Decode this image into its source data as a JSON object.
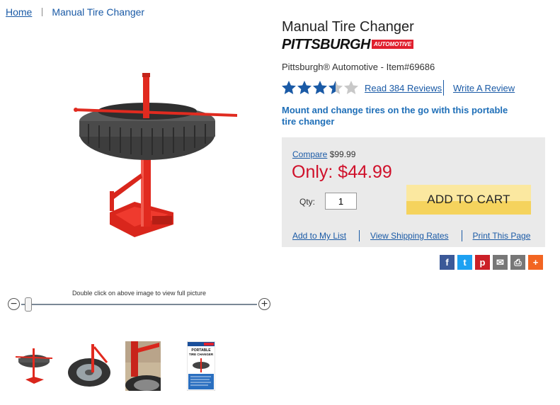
{
  "breadcrumb": {
    "home": "Home",
    "current": "Manual Tire Changer"
  },
  "product": {
    "title": "Manual Tire Changer",
    "brand_main": "PITTSBURGH",
    "brand_sub": "AUTOMOTIVE",
    "subtitle": "Pittsburgh® Automotive - Item#69686",
    "rating": 3.5,
    "rating_max": 5,
    "reviews_link": "Read 384 Reviews",
    "write_review": "Write A Review",
    "tagline": "Mount and change tires on the go with this portable tire changer"
  },
  "pricing": {
    "compare_label": "Compare",
    "compare_price": "$99.99",
    "only_label": "Only: $44.99",
    "qty_label": "Qty:",
    "qty_value": "1",
    "add_to_cart": "ADD TO CART",
    "links": [
      "Add to My List",
      "View Shipping Rates",
      "Print This Page"
    ]
  },
  "image_viewer": {
    "caption": "Double click on above image to view full picture",
    "zoom_level": 0
  },
  "thumb_text": {
    "title_line1": "PORTABLE",
    "title_line2": "TIRE CHANGER"
  },
  "share": [
    {
      "icon": "facebook-icon",
      "color": "#3b5998",
      "glyph": "f"
    },
    {
      "icon": "twitter-icon",
      "color": "#1da1f2",
      "glyph": "t"
    },
    {
      "icon": "pinterest-icon",
      "color": "#cb2027",
      "glyph": "p"
    },
    {
      "icon": "email-icon",
      "color": "#777777",
      "glyph": "✉"
    },
    {
      "icon": "print-icon",
      "color": "#777777",
      "glyph": "⎙"
    },
    {
      "icon": "more-share-icon",
      "color": "#f26522",
      "glyph": "+"
    }
  ],
  "colors": {
    "accent": "#1a5aa6",
    "price": "#d0112b",
    "cart_button": "#f5d35d",
    "brand_red": "#e0202e",
    "star": "#1a5aa6"
  }
}
